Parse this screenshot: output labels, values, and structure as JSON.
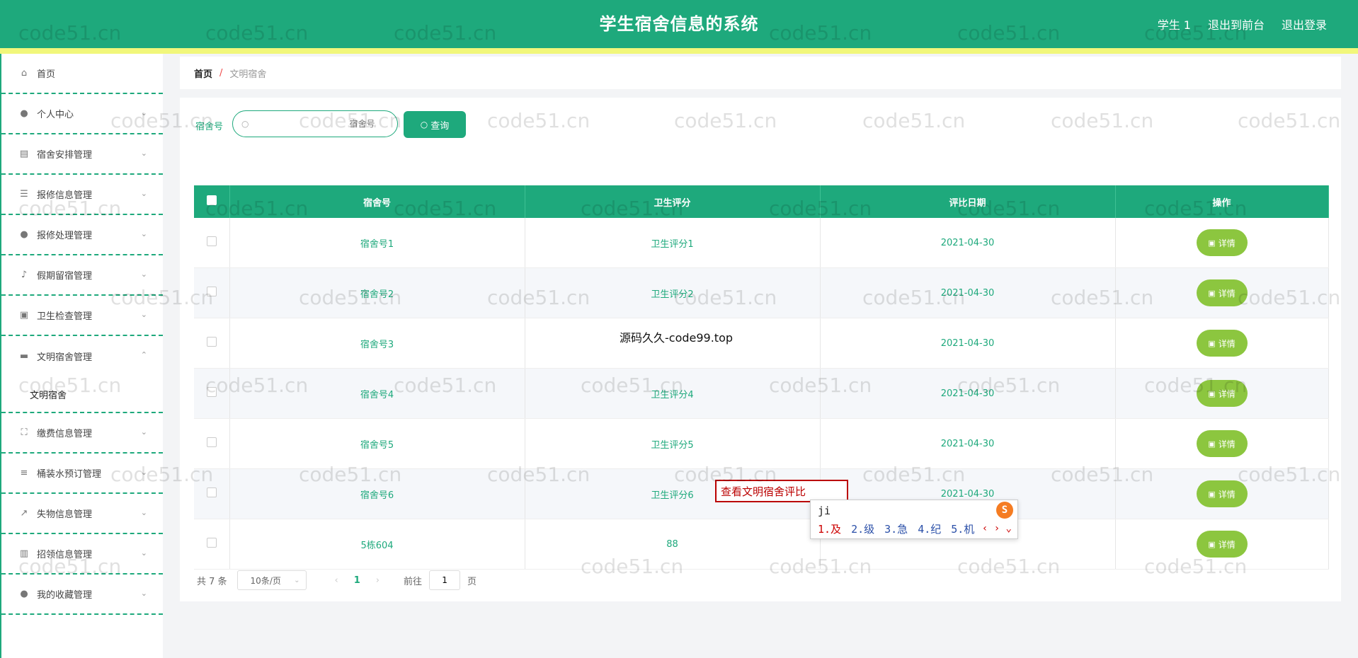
{
  "header": {
    "title": "学生宿舍信息的系统",
    "user_label": "学生 1",
    "front_label": "退出到前台",
    "logout_label": "退出登录"
  },
  "sidebar": {
    "items": [
      {
        "label": "首页",
        "icon": "home-icon"
      },
      {
        "label": "个人中心",
        "icon": "user-icon"
      },
      {
        "label": "宿舍安排管理",
        "icon": "clipboard-icon"
      },
      {
        "label": "报修信息管理",
        "icon": "sliders-icon"
      },
      {
        "label": "报修处理管理",
        "icon": "user-icon"
      },
      {
        "label": "假期留宿管理",
        "icon": "microphone-icon"
      },
      {
        "label": "卫生检查管理",
        "icon": "briefcase-icon"
      },
      {
        "label": "文明宿舍管理",
        "icon": "stack-icon"
      },
      {
        "label": "缴费信息管理",
        "icon": "fullscreen-icon"
      },
      {
        "label": "桶装水预订管理",
        "icon": "menu-icon"
      },
      {
        "label": "失物信息管理",
        "icon": "chart-icon"
      },
      {
        "label": "招领信息管理",
        "icon": "board-icon"
      },
      {
        "label": "我的收藏管理",
        "icon": "user-icon"
      }
    ],
    "active_sub": "文明宿舍"
  },
  "breadcrumb": {
    "home": "首页",
    "sep": "/",
    "current": "文明宿舍"
  },
  "search": {
    "label": "宿舍号",
    "placeholder": "宿舍号",
    "button": "查询"
  },
  "table": {
    "headers": [
      "宿舍号",
      "卫生评分",
      "评比日期",
      "操作"
    ],
    "rows": [
      {
        "room": "宿舍号1",
        "score": "卫生评分1",
        "date": "2021-04-30"
      },
      {
        "room": "宿舍号2",
        "score": "卫生评分2",
        "date": "2021-04-30"
      },
      {
        "room": "宿舍号3",
        "score": "",
        "date": "2021-04-30"
      },
      {
        "room": "宿舍号4",
        "score": "卫生评分4",
        "date": "2021-04-30"
      },
      {
        "room": "宿舍号5",
        "score": "卫生评分5",
        "date": "2021-04-30"
      },
      {
        "room": "宿舍号6",
        "score": "卫生评分6",
        "date": "2021-04-30"
      },
      {
        "room": "5栋604",
        "score": "88",
        "date": ""
      }
    ],
    "action_label": "详情"
  },
  "pager": {
    "total": "共 7 条",
    "size": "10条/页",
    "page": "1",
    "goto_label": "前往",
    "goto_value": "1",
    "page_unit": "页"
  },
  "overlay": {
    "source_text": "源码久久-code99.top",
    "tooltip_text": "查看文明宿舍评比",
    "ime_pinyin": "ji",
    "ime_candidates": [
      "1.及",
      "2.级",
      "3.急",
      "4.纪",
      "5.机"
    ],
    "ime_logo": "S"
  },
  "watermark": "code51.cn",
  "colors": {
    "primary": "#1ea97c",
    "accent_stripe": "#f1f77b",
    "detail_button": "#8cc63f"
  }
}
